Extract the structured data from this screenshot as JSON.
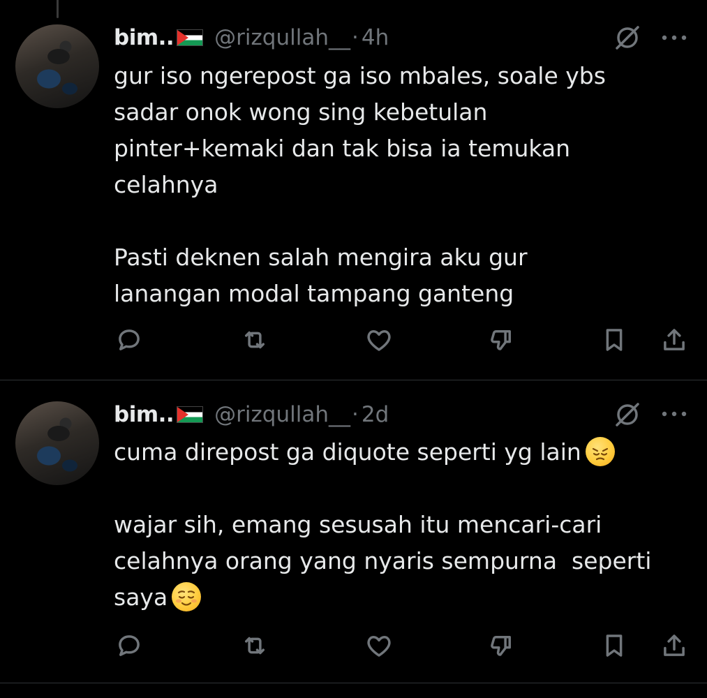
{
  "tweets": [
    {
      "display_name": "bim..",
      "handle": "@rizqullah__",
      "separator": "·",
      "time": "4h",
      "text_html": "gur iso ngerepost ga iso mbales, soale ybs\nsadar onok wong sing kebetulan\npinter+kemaki dan tak bisa ia temukan\ncelahnya\n\nPasti deknen salah mengira aku gur\nlanangan modal tampang ganteng"
    },
    {
      "display_name": "bim..",
      "handle": "@rizqullah__",
      "separator": "·",
      "time": "2d",
      "text_line1": "cuma direpost ga diquote seperti yg lain",
      "text_mid": "\n\nwajar sih, emang sesusah itu mencari-cari\ncelahnya orang yang nyaris sempurna  seperti\nsaya"
    }
  ],
  "icons": {
    "flag": "palestine-flag",
    "grok": "grok-icon",
    "more": "more-icon",
    "reply": "reply-icon",
    "repost": "repost-icon",
    "like": "like-icon",
    "dislike": "dislike-icon",
    "bookmark": "bookmark-icon",
    "share": "share-icon",
    "emoji1": "pensive-face",
    "emoji2": "relieved-face"
  },
  "colors": {
    "background": "#000000",
    "text": "#e7e9ea",
    "secondary": "#71767b",
    "divider": "#2f3336"
  }
}
